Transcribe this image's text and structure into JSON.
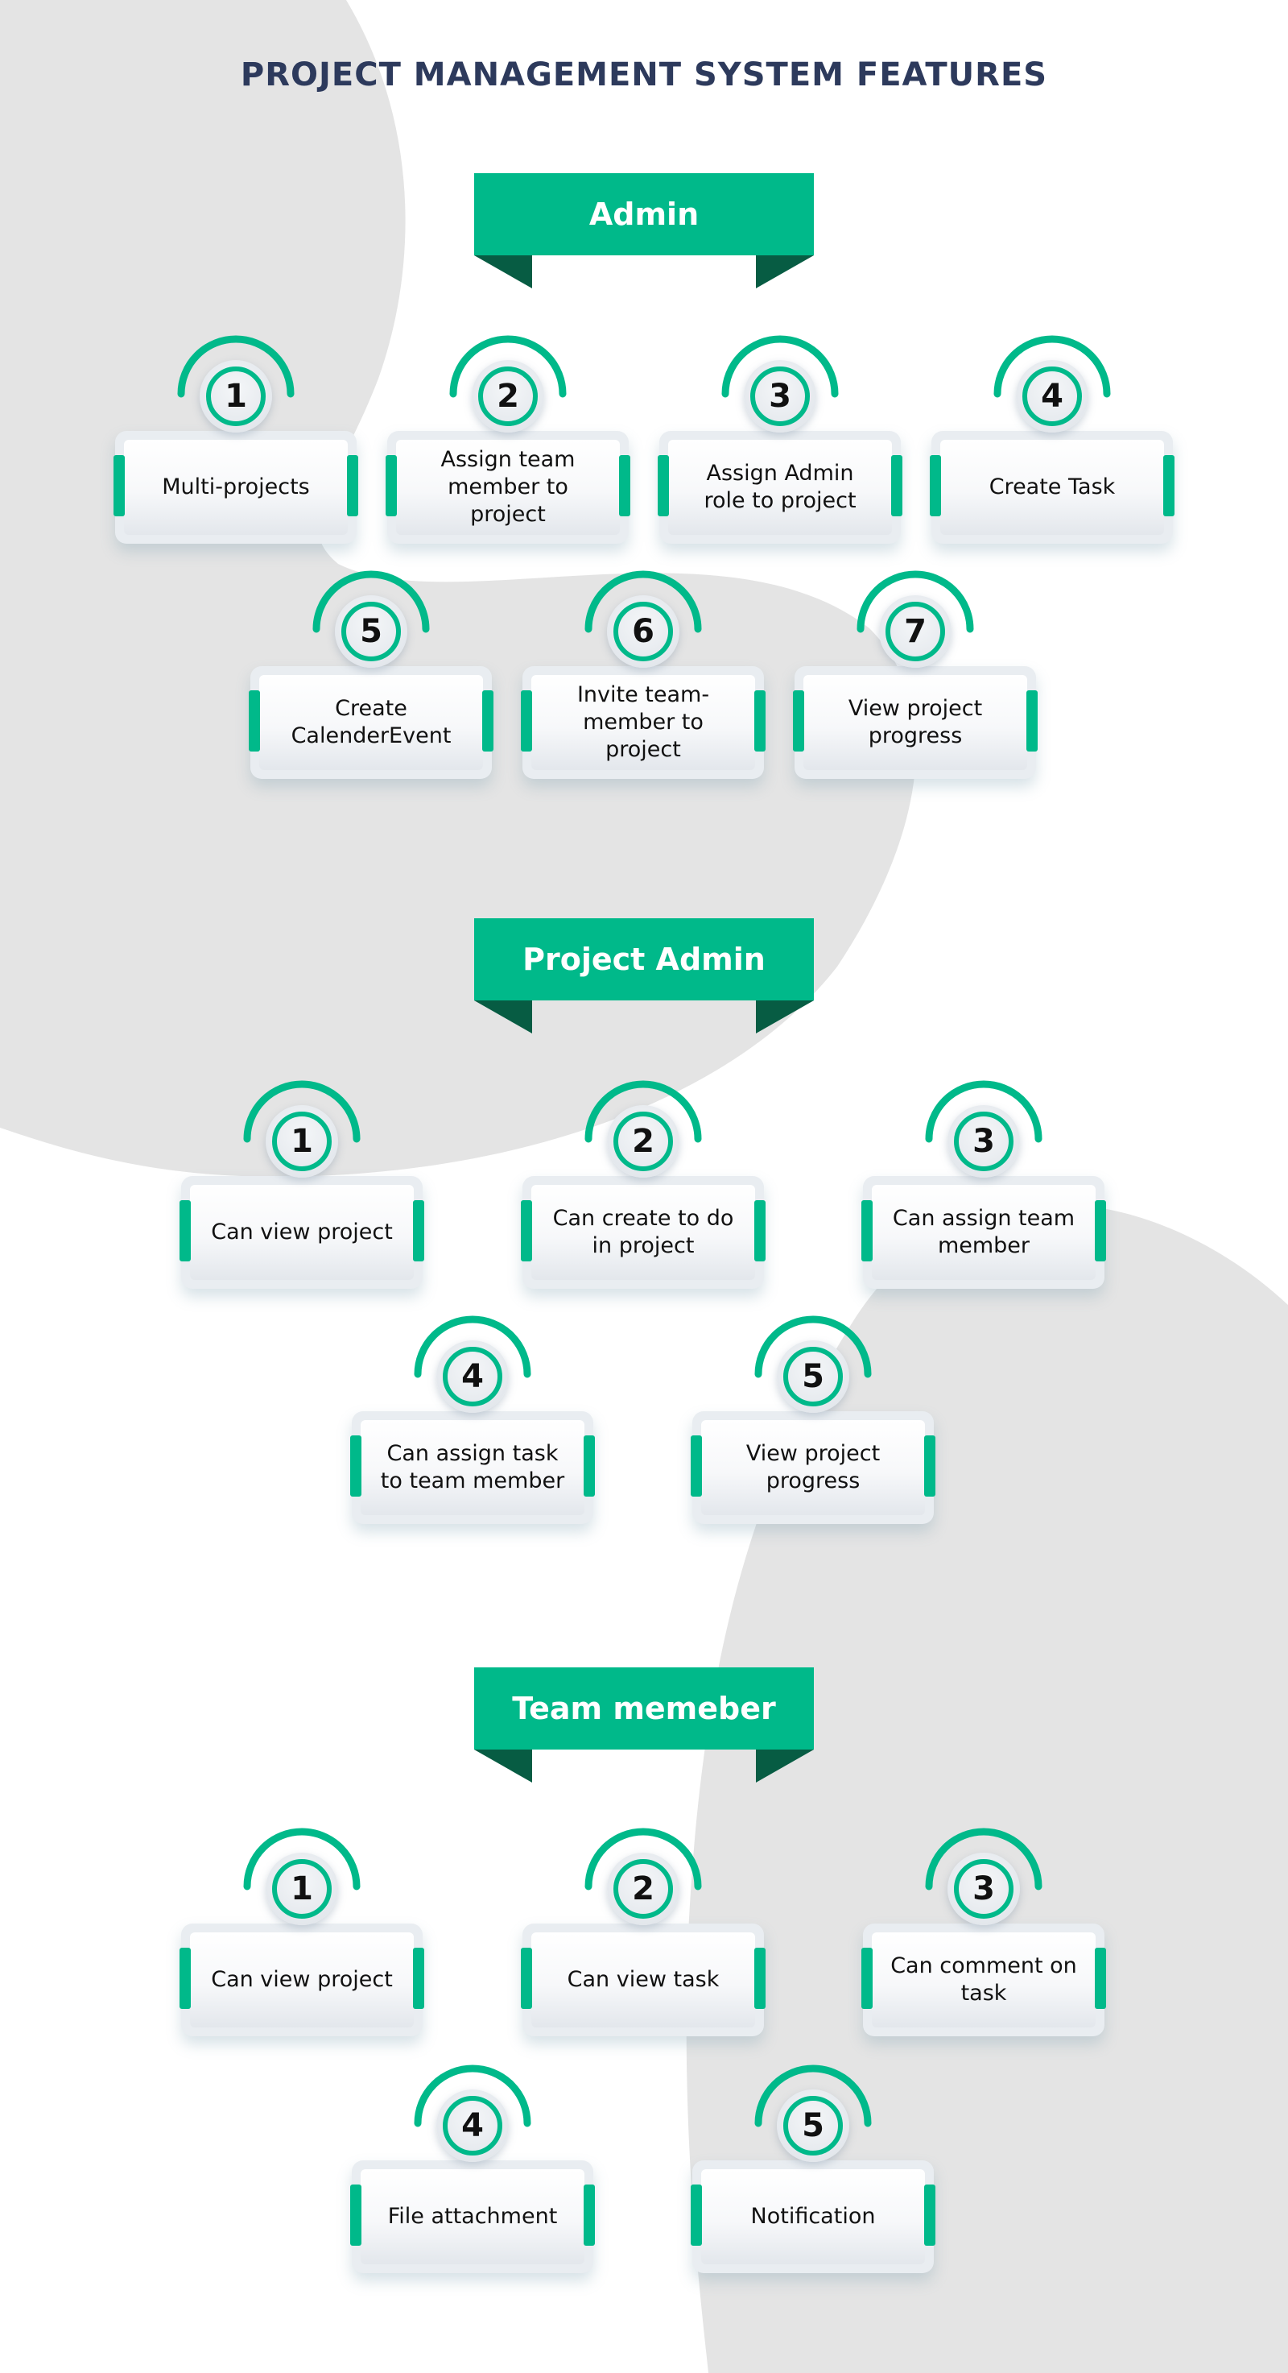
{
  "title": "PROJECT MANAGEMENT SYSTEM FEATURES",
  "colors": {
    "accent": "#00b98a",
    "accent_dark": "#075c43",
    "title": "#2d3a5c",
    "background_shape": "#e4e4e4"
  },
  "sections": [
    {
      "label": "Admin",
      "features": [
        {
          "number": "1",
          "text": "Multi-projects"
        },
        {
          "number": "2",
          "text": "Assign team member to project"
        },
        {
          "number": "3",
          "text": "Assign Admin role to project"
        },
        {
          "number": "4",
          "text": "Create Task"
        },
        {
          "number": "5",
          "text": "Create CalenderEvent"
        },
        {
          "number": "6",
          "text": "Invite team-member to project"
        },
        {
          "number": "7",
          "text": "View project progress"
        }
      ]
    },
    {
      "label": "Project Admin",
      "features": [
        {
          "number": "1",
          "text": "Can view project"
        },
        {
          "number": "2",
          "text": "Can create to do in project"
        },
        {
          "number": "3",
          "text": "Can assign team member"
        },
        {
          "number": "4",
          "text": "Can assign task to team member"
        },
        {
          "number": "5",
          "text": "View project progress"
        }
      ]
    },
    {
      "label": "Team memeber",
      "features": [
        {
          "number": "1",
          "text": "Can view project"
        },
        {
          "number": "2",
          "text": "Can view task"
        },
        {
          "number": "3",
          "text": "Can comment on task"
        },
        {
          "number": "4",
          "text": "File attachment"
        },
        {
          "number": "5",
          "text": "Notification"
        }
      ]
    }
  ]
}
